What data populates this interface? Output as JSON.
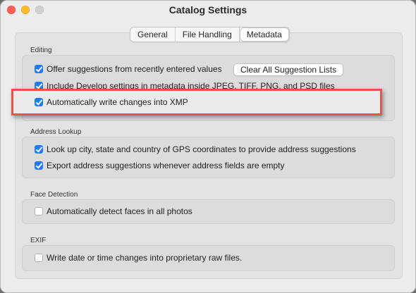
{
  "window": {
    "title": "Catalog Settings"
  },
  "tabs": [
    {
      "label": "General",
      "selected": false
    },
    {
      "label": "File Handling",
      "selected": false
    },
    {
      "label": "Metadata",
      "selected": true
    }
  ],
  "editing": {
    "label": "Editing",
    "offer_suggestions": {
      "label": "Offer suggestions from recently entered values",
      "checked": true
    },
    "clear_button": "Clear All Suggestion Lists",
    "include_develop": {
      "label": "Include Develop settings in metadata inside JPEG, TIFF, PNG, and PSD files",
      "checked": true
    },
    "auto_write_xmp": {
      "label": "Automatically write changes into XMP",
      "checked": true
    }
  },
  "address_lookup": {
    "label": "Address Lookup",
    "gps_lookup": {
      "label": "Look up city, state and country of GPS coordinates to provide address suggestions",
      "checked": true
    },
    "export_suggestions": {
      "label": "Export address suggestions whenever address fields are empty",
      "checked": true
    }
  },
  "face_detection": {
    "label": "Face Detection",
    "auto_detect": {
      "label": "Automatically detect faces in all photos",
      "checked": false
    }
  },
  "exif": {
    "label": "EXIF",
    "write_date": {
      "label": "Write date or time changes into proprietary raw files.",
      "checked": false
    }
  },
  "colors": {
    "accent": "#1f7cf6",
    "highlight_border": "#e8534c"
  }
}
